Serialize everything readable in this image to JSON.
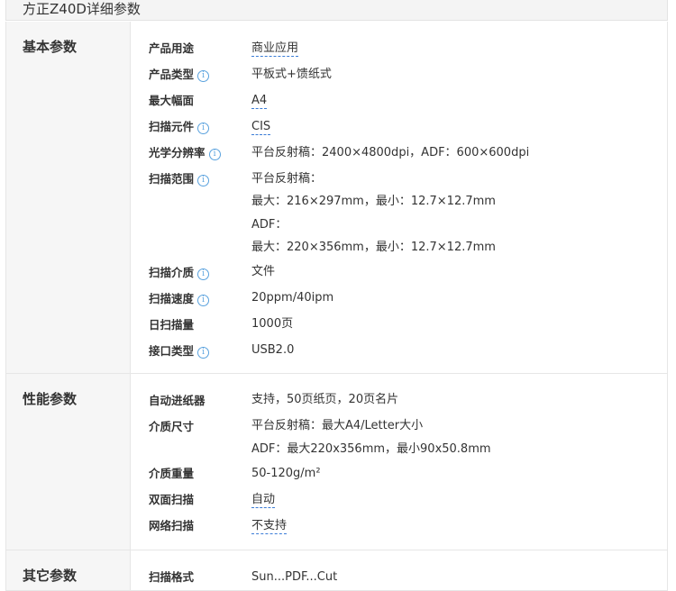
{
  "page_title": "方正Z40D详细参数",
  "sections": [
    {
      "label": "基本参数",
      "rows": [
        {
          "name": "产品用途",
          "info": false,
          "values": [
            "商业应用"
          ],
          "link": true
        },
        {
          "name": "产品类型",
          "info": true,
          "values": [
            "平板式+馈纸式"
          ],
          "link": false
        },
        {
          "name": "最大幅面",
          "info": false,
          "values": [
            "A4"
          ],
          "link": true
        },
        {
          "name": "扫描元件",
          "info": true,
          "values": [
            "CIS"
          ],
          "link": true
        },
        {
          "name": "光学分辨率",
          "info": true,
          "values": [
            "平台反射稿：2400×4800dpi，ADF：600×600dpi"
          ],
          "link": false
        },
        {
          "name": "扫描范围",
          "info": true,
          "values": [
            "平台反射稿：",
            "最大：216×297mm，最小：12.7×12.7mm",
            "ADF：",
            "最大：220×356mm，最小：12.7×12.7mm"
          ],
          "link": false
        },
        {
          "name": "扫描介质",
          "info": true,
          "values": [
            "文件"
          ],
          "link": false
        },
        {
          "name": "扫描速度",
          "info": true,
          "values": [
            "20ppm/40ipm"
          ],
          "link": false
        },
        {
          "name": "日扫描量",
          "info": false,
          "values": [
            "1000页"
          ],
          "link": false
        },
        {
          "name": "接口类型",
          "info": true,
          "values": [
            "USB2.0"
          ],
          "link": false
        }
      ]
    },
    {
      "label": "性能参数",
      "rows": [
        {
          "name": "自动进纸器",
          "info": false,
          "values": [
            "支持，50页纸页，20页名片"
          ],
          "link": false
        },
        {
          "name": "介质尺寸",
          "info": false,
          "values": [
            "平台反射稿：最大A4/Letter大小",
            "ADF：最大220x356mm，最小90x50.8mm"
          ],
          "link": false
        },
        {
          "name": "介质重量",
          "info": false,
          "values": [
            "50-120g/m²"
          ],
          "link": false
        },
        {
          "name": "双面扫描",
          "info": false,
          "values": [
            "自动"
          ],
          "link": true
        },
        {
          "name": "网络扫描",
          "info": false,
          "values": [
            "不支持"
          ],
          "link": true
        }
      ]
    },
    {
      "label": "其它参数",
      "rows": [
        {
          "name": "扫描格式",
          "info": false,
          "values": [
            "Sun...PDF...Cut"
          ],
          "link": false
        }
      ]
    }
  ],
  "colors": {
    "accent": "#3a7cd6",
    "info": "#5aa2de",
    "category_bg": "#f6f6f6"
  }
}
